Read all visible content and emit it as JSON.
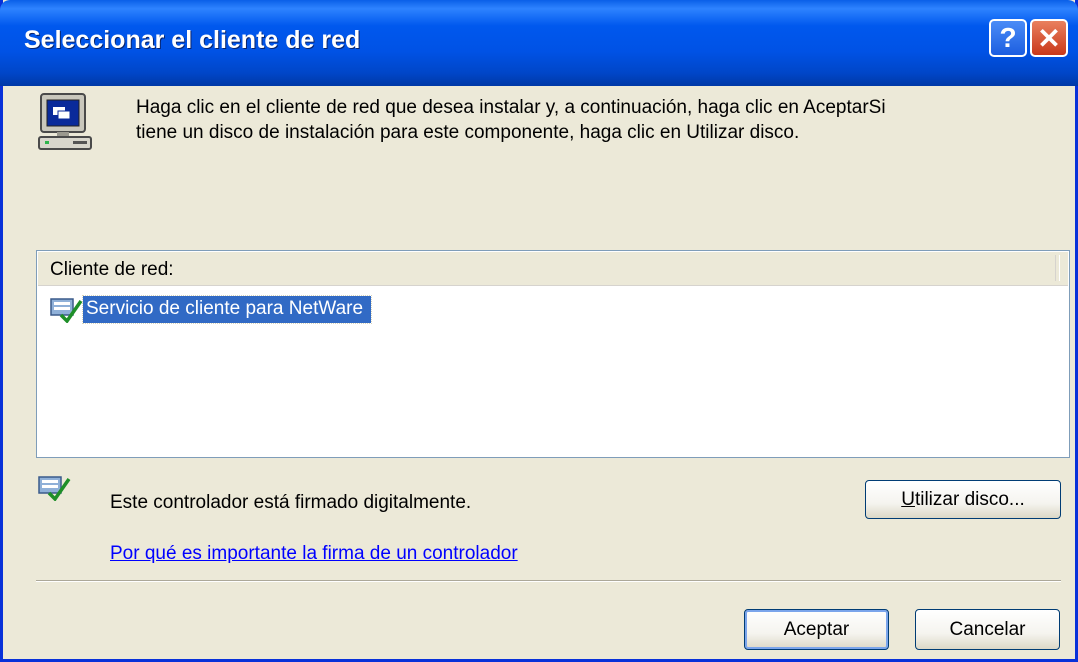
{
  "window": {
    "title": "Seleccionar el cliente de red",
    "help_button": "?",
    "close_button": "✕"
  },
  "intro": {
    "text": "Haga clic en el cliente de red que desea instalar y, a continuación, haga clic en AceptarSi tiene un disco de instalación para este componente, haga clic en Utilizar disco.",
    "icon": "computer-icon"
  },
  "list": {
    "header": "Cliente de red:",
    "items": [
      {
        "label": "Servicio de cliente para NetWare",
        "icon": "network-client-icon",
        "selected": true
      }
    ]
  },
  "signature": {
    "text": "Este controlador está firmado digitalmente.",
    "icon": "signed-driver-icon",
    "link": "Por qué es importante la firma de un controlador"
  },
  "buttons": {
    "use_disk_mnemonic": "U",
    "use_disk_rest": "tilizar disco...",
    "accept": "Aceptar",
    "cancel": "Cancelar"
  }
}
